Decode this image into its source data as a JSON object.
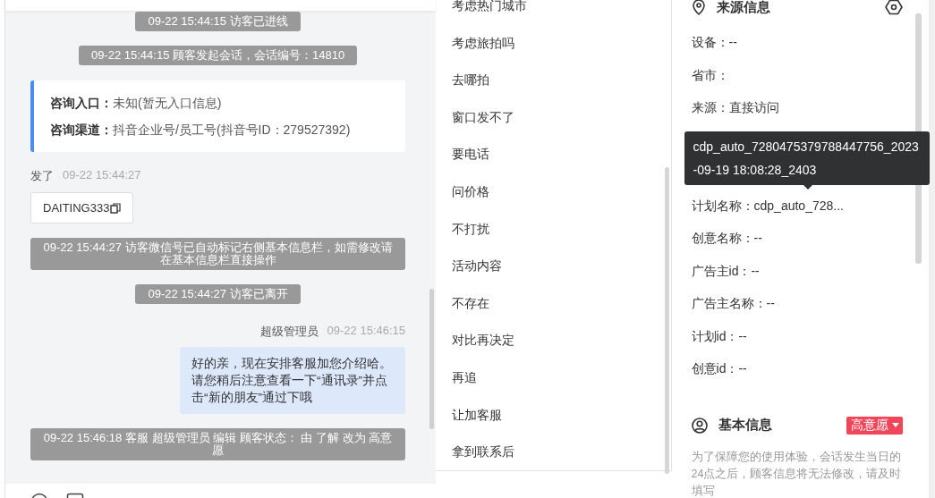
{
  "chat": {
    "messages": [
      {
        "kind": "system",
        "text": "09-22 15:44:15 访客已进线"
      },
      {
        "kind": "system",
        "text": "09-22 15:44:15 顾客发起会话，会话编号：14810"
      },
      {
        "kind": "entry",
        "rows": [
          {
            "label": "咨询入口：",
            "value": "未知(暂无入口信息)"
          },
          {
            "label": "咨询渠道：",
            "value": "抖音企业号/员工号(抖音号ID：279527392)"
          }
        ]
      },
      {
        "kind": "incoming",
        "sender": "发了",
        "time": "09-22 15:44:27",
        "text": "DAITING333"
      },
      {
        "kind": "system",
        "text": "09-22 15:44:27 访客微信号已自动标记右侧基本信息栏，如需修改请在基本信息栏直接操作"
      },
      {
        "kind": "system",
        "text": "09-22 15:44:27 访客已离开"
      },
      {
        "kind": "outgoing",
        "sender": "超级管理员",
        "time": "09-22 15:46:15",
        "text": "好的亲，现在安排客服加您介绍哈。请您稍后注意查看一下“通讯录”并点击“新的朋友”通过下哦"
      },
      {
        "kind": "system",
        "text": "09-22 15:46:18 客服 超级管理员 编辑 顾客状态： 由 了解 改为 高意愿"
      }
    ]
  },
  "quick_replies": [
    "考虑热门城市",
    "考虑旅拍吗",
    "去哪拍",
    "窗口发不了",
    "要电话",
    "问价格",
    "不打扰",
    "活动内容",
    "不存在",
    "对比再决定",
    "再追",
    "让加客服",
    "拿到联系后"
  ],
  "source_info": {
    "title": "来源信息",
    "rows": [
      {
        "kind": "field",
        "text": "设备：--"
      },
      {
        "kind": "field",
        "text": "省市："
      },
      {
        "kind": "field",
        "text": "来源：直接访问"
      },
      {
        "kind": "hidden"
      },
      {
        "kind": "hidden"
      },
      {
        "kind": "field",
        "text": "计划名称：cdp_auto_728..."
      },
      {
        "kind": "field",
        "text": "创意名称：--"
      },
      {
        "kind": "field",
        "text": "广告主id：--"
      },
      {
        "kind": "field",
        "text": "广告主名称：--"
      },
      {
        "kind": "field",
        "text": "计划id：--"
      },
      {
        "kind": "field",
        "text": "创意id：--"
      }
    ],
    "tooltip": "cdp_auto_7280475379788447756_2023-09-19 18:08:28_2403"
  },
  "basic_info": {
    "title": "基本信息",
    "status": "高意愿",
    "note": "为了保障您的使用体验，会话发生当日的24点之后，顾客信息将无法修改，请及时填写"
  }
}
